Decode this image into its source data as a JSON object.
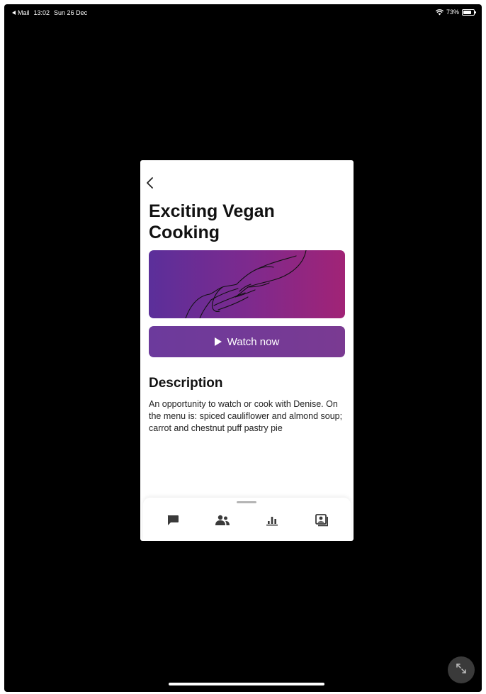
{
  "status_bar": {
    "back_app": "Mail",
    "time": "13:02",
    "date": "Sun 26 Dec",
    "battery": "73%"
  },
  "page": {
    "title": "Exciting Vegan Cooking"
  },
  "watch_button": {
    "label": "Watch now"
  },
  "description": {
    "heading": "Description",
    "text": "An opportunity to watch or cook with Denise. On the menu is: spiced cauliflower and almond soup; carrot and chestnut puff pastry pie"
  },
  "tabs": [
    {
      "icon": "chat-icon"
    },
    {
      "icon": "people-icon"
    },
    {
      "icon": "bar-chart-icon"
    },
    {
      "icon": "contact-card-icon"
    }
  ],
  "colors": {
    "background": "#000000",
    "card": "#ffffff",
    "accent_purple": "#6c3a9c",
    "gradient_pink": "#a12376"
  }
}
